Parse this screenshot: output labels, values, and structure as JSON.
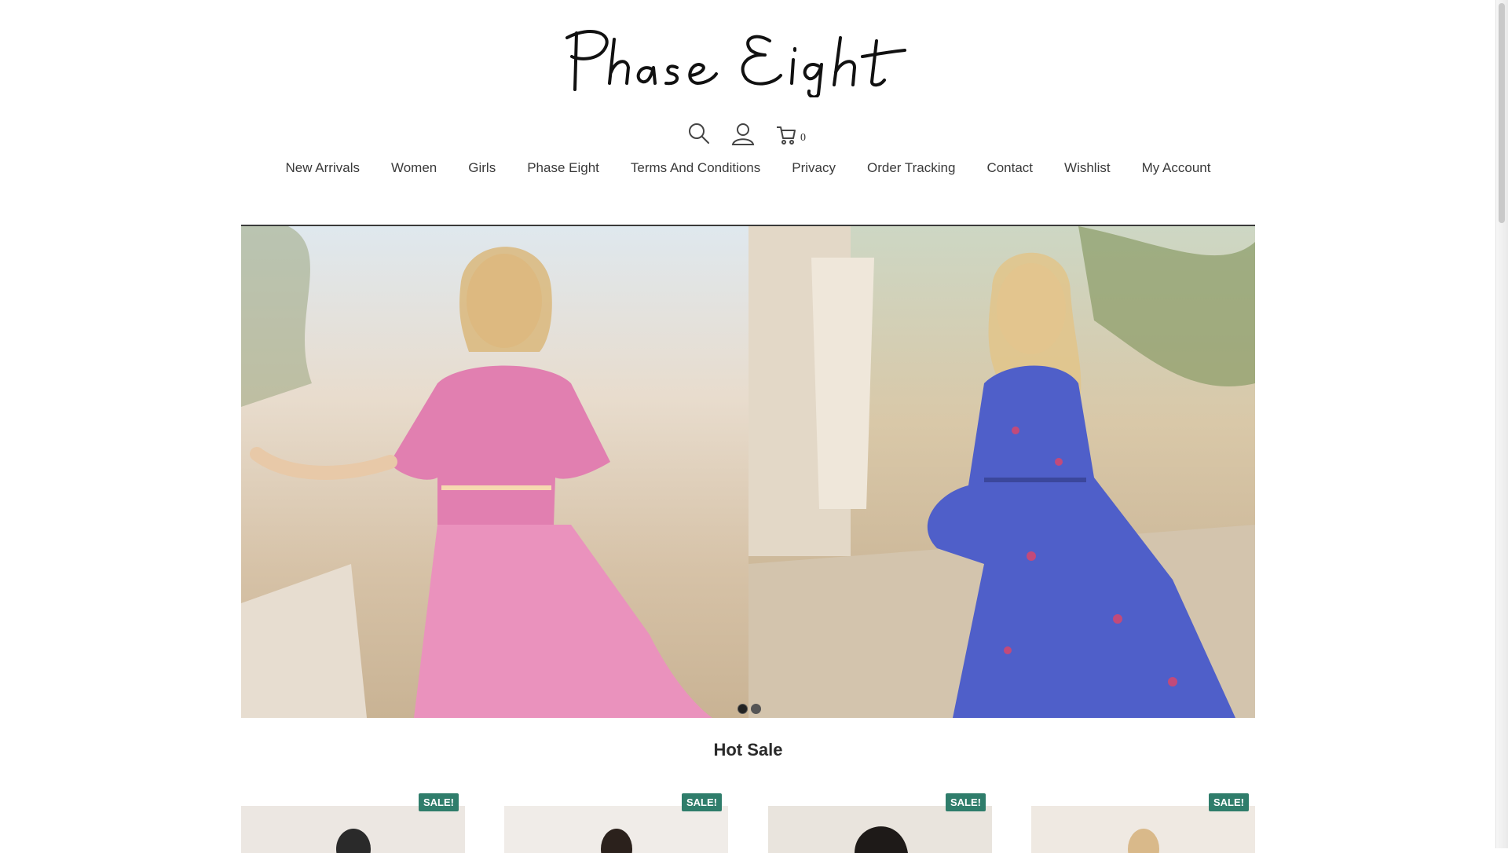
{
  "brand": {
    "logo_text": "Phase Eight"
  },
  "header_icons": {
    "search": "search-icon",
    "account": "user-icon",
    "cart": "cart-icon",
    "cart_count": "0"
  },
  "nav": {
    "items": [
      "New Arrivals",
      "Women",
      "Girls",
      "Phase Eight",
      "Terms And Conditions",
      "Privacy",
      "Order Tracking",
      "Contact",
      "Wishlist",
      "My Account"
    ]
  },
  "hero": {
    "slides": 2,
    "active_slide": 1
  },
  "section": {
    "title": "Hot Sale"
  },
  "products": [
    {
      "badge": "SALE!"
    },
    {
      "badge": "SALE!"
    },
    {
      "badge": "SALE!"
    },
    {
      "badge": "SALE!"
    }
  ],
  "colors": {
    "sale_badge": "#2f7d6b",
    "text": "#3a3a3a"
  }
}
